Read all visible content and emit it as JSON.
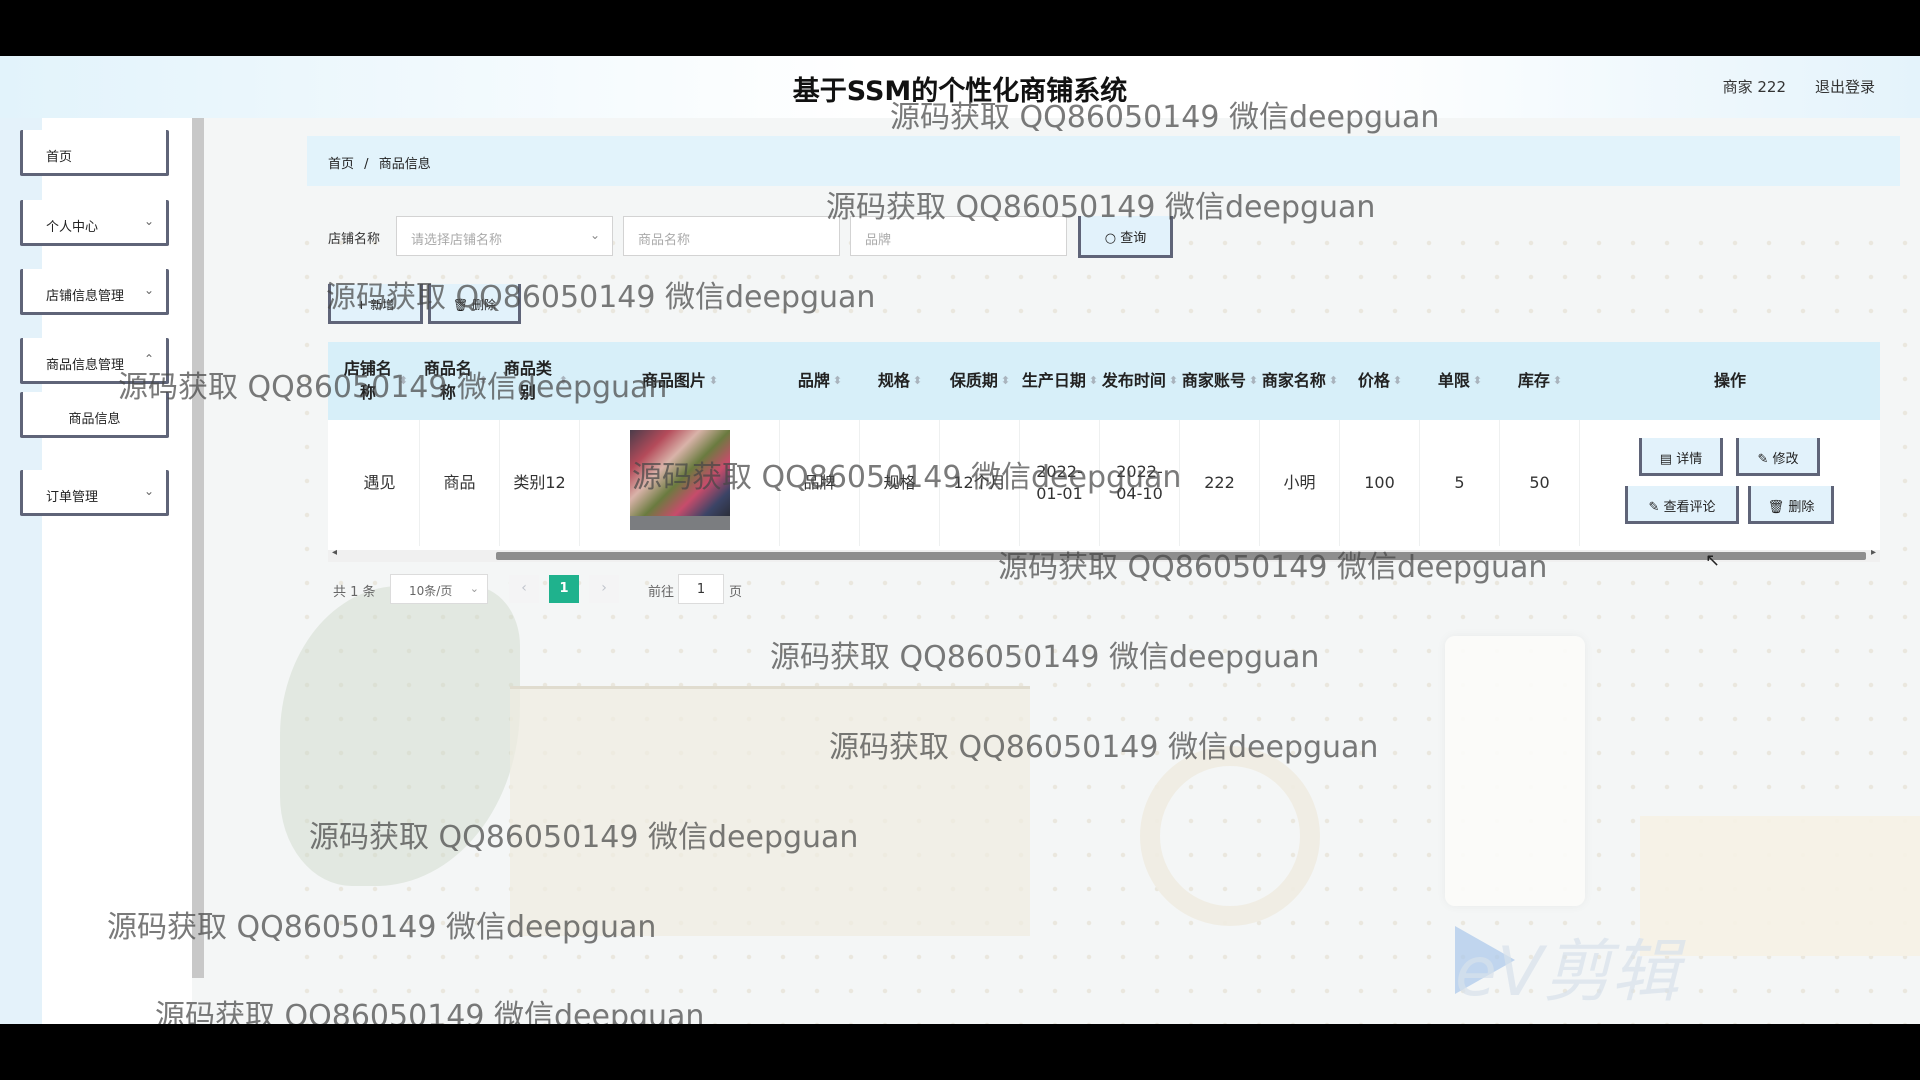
{
  "header": {
    "title": "基于SSM的个性化商铺系统",
    "user": "商家 222",
    "logout": "退出登录"
  },
  "sidebar": {
    "items": [
      {
        "label": "首页"
      },
      {
        "label": "个人中心"
      },
      {
        "label": "店铺信息管理"
      },
      {
        "label": "商品信息管理"
      },
      {
        "label": "商品信息"
      },
      {
        "label": "订单管理"
      }
    ]
  },
  "breadcrumb": {
    "home": "首页",
    "sep": "/",
    "current": "商品信息"
  },
  "search": {
    "shop_label": "店铺名称",
    "shop_placeholder": "请选择店铺名称",
    "product_placeholder": "商品名称",
    "brand_placeholder": "品牌",
    "query_label": "查询",
    "add_label": "新增",
    "delete_label": "删除"
  },
  "table": {
    "columns": [
      "店铺名称",
      "商品名称",
      "商品类别",
      "商品图片",
      "品牌",
      "规格",
      "保质期",
      "生产日期",
      "发布时间",
      "商家账号",
      "商家名称",
      "价格",
      "单限",
      "库存",
      "操作"
    ],
    "rows": [
      {
        "shop": "遇见",
        "name": "商品",
        "category": "类别12",
        "brand": "品牌",
        "spec": "规格",
        "shelf_life": "12个月",
        "prod_date": "2022-01-01",
        "pub_date": "2022-04-10",
        "account": "222",
        "merchant": "小明",
        "price": "100",
        "limit": "5",
        "stock": "50"
      }
    ],
    "actions": {
      "detail": "详情",
      "edit": "修改",
      "review": "查看评论",
      "delete": "删除"
    }
  },
  "pagination": {
    "total": "共 1 条",
    "page_size": "10条/页",
    "current_page": "1",
    "goto_label": "前往",
    "goto_value": "1",
    "unit": "页"
  },
  "watermark": "源码获取 QQ86050149 微信deepguan",
  "video_logo": "eV剪辑"
}
